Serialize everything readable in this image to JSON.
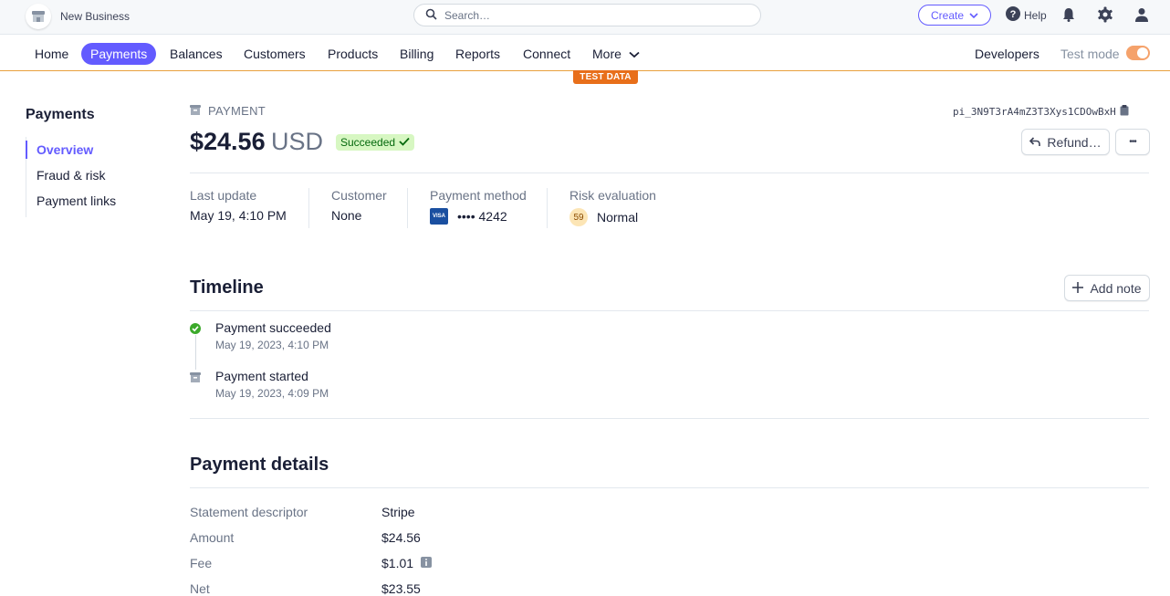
{
  "topbar": {
    "business_name": "New Business",
    "search_placeholder": "Search…",
    "create_label": "Create",
    "help_label": "Help"
  },
  "nav": {
    "items": [
      "Home",
      "Payments",
      "Balances",
      "Customers",
      "Products",
      "Billing",
      "Reports",
      "Connect",
      "More"
    ],
    "active": "Payments",
    "developers_label": "Developers",
    "test_mode_label": "Test mode",
    "test_mode_on": true,
    "test_data_badge": "TEST DATA"
  },
  "sidebar": {
    "title": "Payments",
    "items": [
      "Overview",
      "Fraud & risk",
      "Payment links"
    ],
    "active": "Overview"
  },
  "payment": {
    "label": "PAYMENT",
    "id": "pi_3N9T3rA4mZ3T3Xys1CDOwBxH",
    "amount": "$24.56",
    "currency": "USD",
    "status": "Succeeded",
    "refund_label": "Refund…",
    "more_label": "•••"
  },
  "summary": {
    "last_update_label": "Last update",
    "last_update_value": "May 19, 4:10 PM",
    "customer_label": "Customer",
    "customer_value": "None",
    "method_label": "Payment method",
    "card_brand": "VISA",
    "card_last4": "•••• 4242",
    "risk_label": "Risk evaluation",
    "risk_score": "59",
    "risk_level": "Normal"
  },
  "timeline": {
    "title": "Timeline",
    "add_note_label": "Add note",
    "events": [
      {
        "title": "Payment succeeded",
        "time": "May 19, 2023, 4:10 PM"
      },
      {
        "title": "Payment started",
        "time": "May 19, 2023, 4:09 PM"
      }
    ]
  },
  "details": {
    "title": "Payment details",
    "rows": [
      {
        "label": "Statement descriptor",
        "value": "Stripe"
      },
      {
        "label": "Amount",
        "value": "$24.56"
      },
      {
        "label": "Fee",
        "value": "$1.01"
      },
      {
        "label": "Net",
        "value": "$23.55"
      }
    ]
  },
  "colors": {
    "accent": "#635bff",
    "test_orange": "#e86f1a",
    "success_bg": "#d7f7c2",
    "success_text": "#05690d"
  }
}
